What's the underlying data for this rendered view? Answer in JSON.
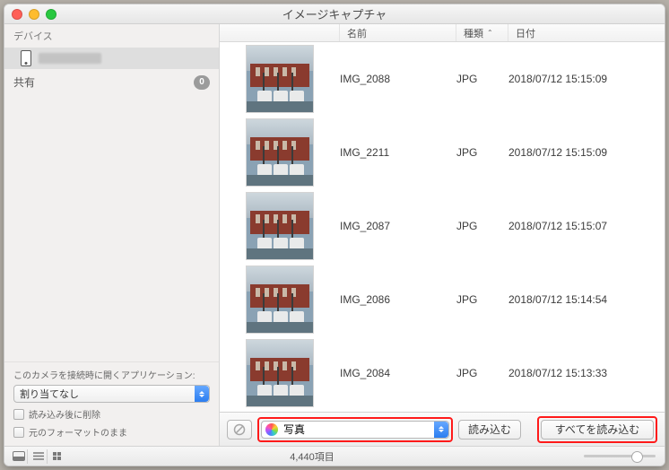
{
  "window": {
    "title": "イメージキャプチャ"
  },
  "sidebar": {
    "devices_header": "デバイス",
    "share_header": "共有",
    "share_count": "0",
    "bottom_label": "このカメラを接続時に開くアプリケーション:",
    "app_select": "割り当てなし",
    "delete_after": "読み込み後に削除",
    "original_format": "元のフォーマットのまま"
  },
  "columns": {
    "name": "名前",
    "type": "種類",
    "date": "日付"
  },
  "rows": [
    {
      "name": "IMG_2088",
      "type": "JPG",
      "date": "2018/07/12 15:15:09"
    },
    {
      "name": "IMG_2211",
      "type": "JPG",
      "date": "2018/07/12 15:15:09"
    },
    {
      "name": "IMG_2087",
      "type": "JPG",
      "date": "2018/07/12 15:15:07"
    },
    {
      "name": "IMG_2086",
      "type": "JPG",
      "date": "2018/07/12 15:14:54"
    },
    {
      "name": "IMG_2084",
      "type": "JPG",
      "date": "2018/07/12 15:13:33"
    }
  ],
  "toolbar": {
    "destination": "写真",
    "import": "読み込む",
    "import_all": "すべてを読み込む"
  },
  "status": {
    "item_count": "4,440項目"
  }
}
